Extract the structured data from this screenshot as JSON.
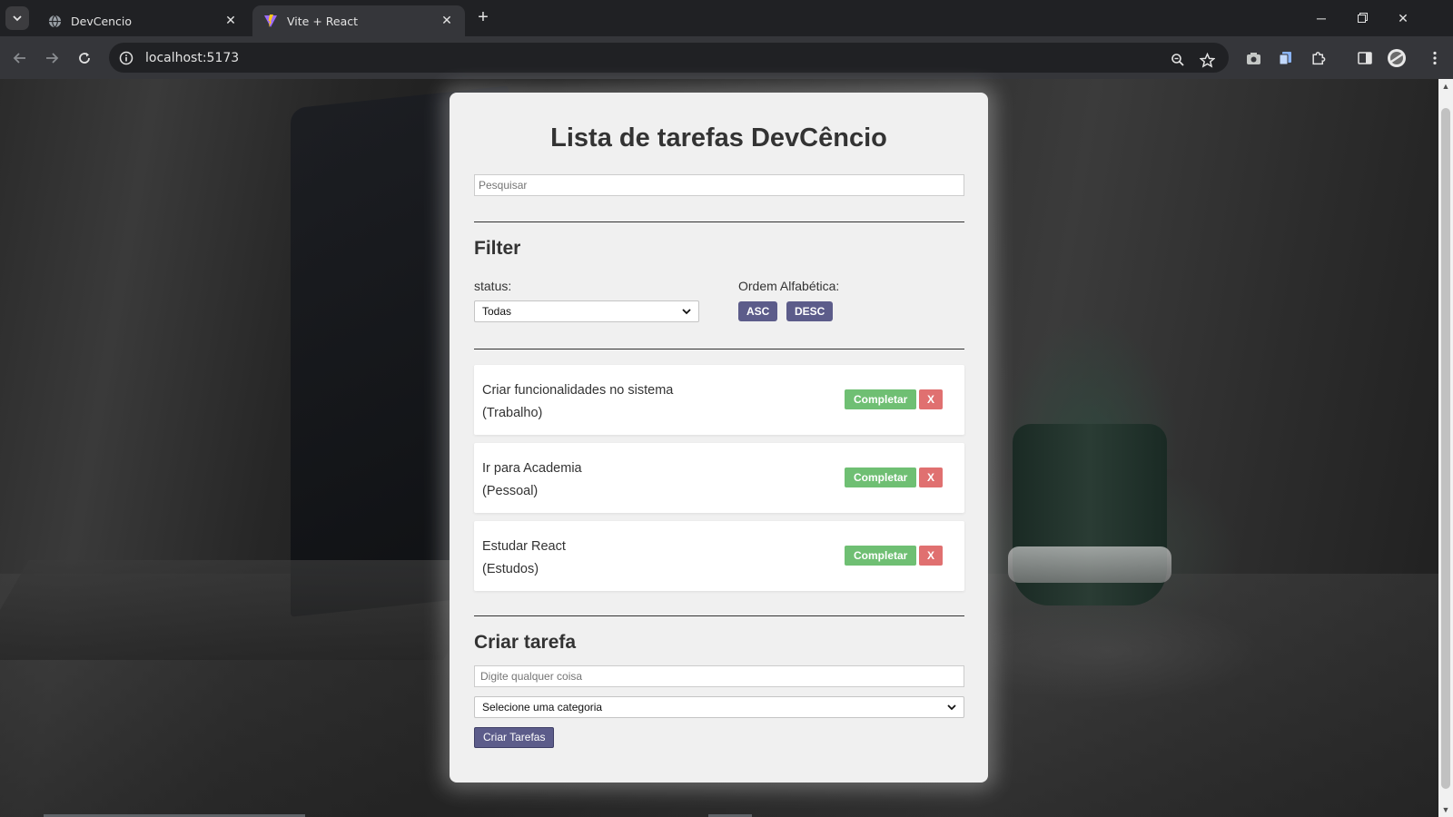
{
  "browser": {
    "tabs": [
      {
        "title": "DevCencio",
        "active": false,
        "favicon": "globe-icon"
      },
      {
        "title": "Vite + React",
        "active": true,
        "favicon": "vite-logo-icon"
      }
    ],
    "url": "localhost:5173",
    "new_tab_label": "+"
  },
  "app": {
    "title": "Lista de tarefas DevCêncio",
    "search_placeholder": "Pesquisar",
    "filter": {
      "heading": "Filter",
      "status_label": "status:",
      "status_selected": "Todas",
      "order_label": "Ordem Alfabética:",
      "asc_label": "ASC",
      "desc_label": "DESC"
    },
    "todos": [
      {
        "text": "Criar funcionalidades no sistema",
        "category": "(Trabalho)"
      },
      {
        "text": "Ir para Academia",
        "category": "(Pessoal)"
      },
      {
        "text": "Estudar React",
        "category": "(Estudos)"
      }
    ],
    "complete_label": "Completar",
    "remove_label": "X",
    "create": {
      "heading": "Criar tarefa",
      "input_placeholder": "Digite qualquer coisa",
      "category_selected": "Selecione uma categoria",
      "submit_label": "Criar Tarefas"
    }
  },
  "colors": {
    "card_bg": "#f0f0f0",
    "primary_button": "#5c5c8a",
    "complete_button": "#6fbf73",
    "remove_button": "#e07070",
    "chrome_dark": "#202124",
    "chrome_toolbar": "#35363a"
  }
}
